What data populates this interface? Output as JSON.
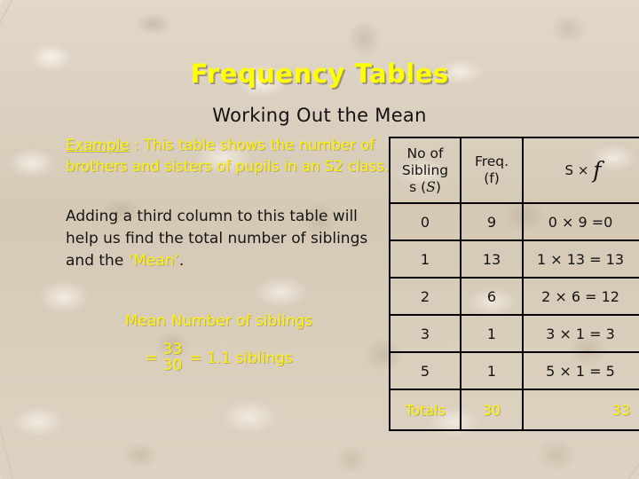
{
  "slide": {
    "title": "Frequency Tables",
    "subtitle": "Working Out the Mean",
    "background_color": "#d9cebd",
    "accent_color": "#FFF200",
    "text_color": "#141414"
  },
  "example": {
    "label": "Example",
    "separator": " : ",
    "body": "This table shows the number of brothers and sisters of pupils in an S2 class."
  },
  "explanation": {
    "part1": "Adding a third column to this table will help us find the total number of siblings and the ",
    "highlight": "‘Mean’",
    "part2": "."
  },
  "mean": {
    "heading": "Mean Number of siblings",
    "equals1": "=",
    "numerator": "33",
    "denominator": "30",
    "result": "= 1.1 siblings"
  },
  "table": {
    "headers": {
      "col1_line1": "No of",
      "col1_line2": "Sibling",
      "col1_line3": "s (",
      "col1_var": "S",
      "col1_line4": ")",
      "col2_line1": "Freq.",
      "col2_line2": "(f)",
      "col3_s": "S",
      "col3_times": " × ",
      "col3_f": "f"
    },
    "rows": [
      {
        "siblings": "0",
        "freq": "9",
        "product": "0 × 9 =0"
      },
      {
        "siblings": "1",
        "freq": "13",
        "product": "1 × 13 = 13"
      },
      {
        "siblings": "2",
        "freq": "6",
        "product": "2 × 6 = 12"
      },
      {
        "siblings": "3",
        "freq": "1",
        "product": "3 × 1 = 3"
      },
      {
        "siblings": "5",
        "freq": "1",
        "product": "5 × 1 = 5"
      }
    ],
    "totals": {
      "label": "Totals",
      "freq_total": "30",
      "product_total": "33"
    }
  }
}
